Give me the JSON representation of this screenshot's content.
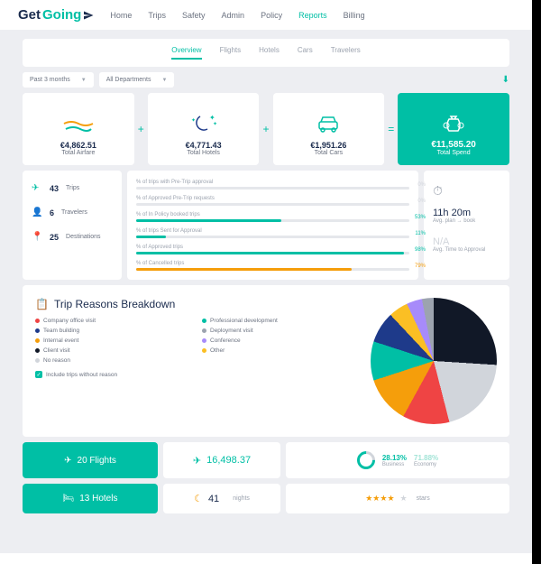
{
  "logo": {
    "get": "Get",
    "going": "Going"
  },
  "nav": [
    "Home",
    "Trips",
    "Safety",
    "Admin",
    "Policy",
    "Reports",
    "Billing"
  ],
  "nav_active": 5,
  "subtabs": [
    "Overview",
    "Flights",
    "Hotels",
    "Cars",
    "Travelers"
  ],
  "subtab_active": 0,
  "filters": {
    "period": "Past 3 months",
    "dept": "All Departments"
  },
  "totals": {
    "airfare": {
      "amount": "€4,862.51",
      "label": "Total Airfare"
    },
    "hotels": {
      "amount": "€4,771.43",
      "label": "Total Hotels"
    },
    "cars": {
      "amount": "€1,951.26",
      "label": "Total Cars"
    },
    "spend": {
      "amount": "€11,585.20",
      "label": "Total Spend"
    }
  },
  "stats": {
    "trips": {
      "n": "43",
      "t": "Trips"
    },
    "travelers": {
      "n": "6",
      "t": "Travelers"
    },
    "destinations": {
      "n": "25",
      "t": "Destinations"
    }
  },
  "bars": [
    {
      "label": "% of trips with Pre-Trip approval",
      "pct": 0,
      "color": "#d1d5db"
    },
    {
      "label": "% of Approved Pre-Trip requests",
      "pct": 0,
      "color": "#d1d5db"
    },
    {
      "label": "% of In Policy booked trips",
      "pct": 53,
      "color": "#00bfa5"
    },
    {
      "label": "% of trips Sent for Approval",
      "pct": 11,
      "color": "#00bfa5"
    },
    {
      "label": "% of Approved trips",
      "pct": 98,
      "color": "#00bfa5"
    },
    {
      "label": "% of Cancelled trips",
      "pct": 79,
      "color": "#f59e0b"
    }
  ],
  "timing": {
    "plan_book": {
      "val": "11h 20m",
      "lbl": "Avg. plan → book"
    },
    "approval": {
      "val": "N/A",
      "lbl": "Avg. Time to Approval"
    }
  },
  "reasons": {
    "title": "Trip Reasons Breakdown",
    "items": [
      {
        "label": "Company office visit",
        "color": "#ef4444"
      },
      {
        "label": "Professional development",
        "color": "#00bfa5"
      },
      {
        "label": "Team building",
        "color": "#1e3a8a"
      },
      {
        "label": "Deployment visit",
        "color": "#9ca3af"
      },
      {
        "label": "Internal event",
        "color": "#f59e0b"
      },
      {
        "label": "Conference",
        "color": "#a78bfa"
      },
      {
        "label": "Client visit",
        "color": "#111827"
      },
      {
        "label": "Other",
        "color": "#fbbf24"
      },
      {
        "label": "No reason",
        "color": "#d1d5db"
      }
    ],
    "checkbox": "Include trips without reason"
  },
  "chart_data": {
    "type": "pie",
    "title": "Trip Reasons Breakdown",
    "series": [
      {
        "name": "Client visit",
        "value": 26,
        "color": "#111827"
      },
      {
        "name": "No reason",
        "value": 20,
        "color": "#d1d5db"
      },
      {
        "name": "Company office visit",
        "value": 12,
        "color": "#ef4444"
      },
      {
        "name": "Internal event",
        "value": 12,
        "color": "#f59e0b"
      },
      {
        "name": "Professional development",
        "value": 10,
        "color": "#00bfa5"
      },
      {
        "name": "Team building",
        "value": 8,
        "color": "#1e3a8a"
      },
      {
        "name": "Other",
        "value": 5,
        "color": "#fbbf24"
      },
      {
        "name": "Conference",
        "value": 4,
        "color": "#a78bfa"
      },
      {
        "name": "Deployment visit",
        "value": 3,
        "color": "#9ca3af"
      }
    ]
  },
  "flights": {
    "label": "20 Flights",
    "cost": "16,498.37",
    "business_pct": "28.13%",
    "business_lbl": "Business",
    "economy_pct": "71.88%",
    "economy_lbl": "Economy"
  },
  "hotels_row": {
    "label": "13 Hotels",
    "nights": "41",
    "nights_lbl": "nights",
    "stars_lbl": "stars"
  }
}
